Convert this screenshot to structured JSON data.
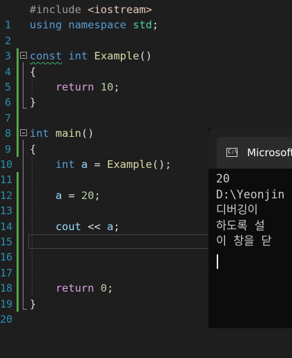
{
  "editor": {
    "line_numbers": [
      "1",
      "2",
      "3",
      "4",
      "5",
      "6",
      "7",
      "8",
      "9",
      "10",
      "11",
      "12",
      "13",
      "14",
      "15",
      "16",
      "17",
      "18",
      "19",
      "20"
    ],
    "tokens": {
      "l1_directive": "#include",
      "l1_header": "<iostream>",
      "l2_using": "using",
      "l2_namespace": "namespace",
      "l2_std": "std",
      "l2_semi": ";",
      "l4_const": "const",
      "l4_int": "int",
      "l4_fn": "Example",
      "l4_parens": "()",
      "open_brace": "{",
      "close_brace": "}",
      "l6_return": "return",
      "l6_num": "10",
      "l6_semi": ";",
      "l9_int": "int",
      "l9_fn": "main",
      "l9_parens": "()",
      "l11_int": "int",
      "l11_var": "a",
      "l11_eq": " = ",
      "l11_fn": "Example",
      "l11_tail": "();",
      "l13_var": "a",
      "l13_eq": " = ",
      "l13_num": "20",
      "l13_semi": ";",
      "l15_cout": "cout",
      "l15_op": " << ",
      "l15_var": "a",
      "l15_semi": ";",
      "l19_return": "return",
      "l19_num": "0",
      "l19_semi": ";"
    }
  },
  "console": {
    "tab_icon_text": "C:\\",
    "tab_title": "Microsoft",
    "output_lines": [
      "20",
      "D:\\Yeonjin",
      "디버깅이",
      "하도록 설",
      "이 창을 닫"
    ]
  },
  "colors": {
    "editor_bg": "#1e1e1e",
    "keyword": "#569cd6",
    "control_keyword": "#d8a0df",
    "function": "#dcdcaa",
    "variable": "#9cdcfe",
    "number": "#b5cea8",
    "line_number": "#2b91af",
    "change_bar_saved": "#57a64a",
    "change_bar_unsaved": "#efef91",
    "console_bg": "#0c0c0c"
  }
}
